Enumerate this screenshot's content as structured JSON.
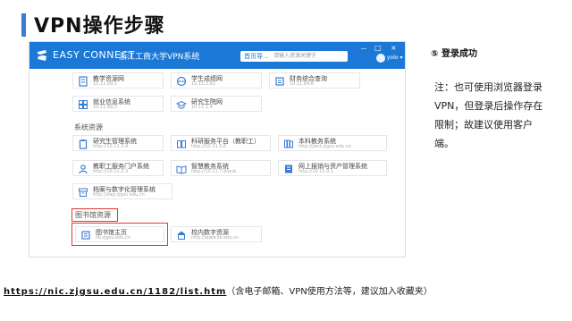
{
  "slide_title": "VPN操作步骤",
  "app": {
    "brand": "EASY CONNECT",
    "system_name": "浙江工商大学VPN系统",
    "nav_button": "首页导...",
    "search_placeholder": "请输入资源关键字",
    "window_controls": [
      "－",
      "□",
      "×"
    ],
    "user": "yolo ▾"
  },
  "resources": {
    "row1": [
      {
        "title": "教学资源网",
        "sub": "10.11.89.1"
      },
      {
        "title": "学生成绩网",
        "sub": "10.11.3.62"
      },
      {
        "title": "财务综合查询",
        "sub": "10.11.84.6"
      }
    ],
    "row2": [
      {
        "title": "就业信息系统",
        "sub": "10.11.89.2"
      },
      {
        "title": "研究生院网",
        "sub": "10.11.1.4"
      }
    ],
    "section_label": "系统资源",
    "row3": [
      {
        "title": "研究生管理系统",
        "sub": "http://10.11.3.4"
      },
      {
        "title": "科研服务平台（教职工）",
        "sub": "http://10.11.5.6"
      },
      {
        "title": "本科教务系统",
        "sub": "http://jwxt.zjgsu.edu.cn"
      }
    ],
    "row4": [
      {
        "title": "教职工服务门户系统",
        "sub": "http://10.11.2.3"
      },
      {
        "title": "智慧教务系统",
        "sub": "http://10.11.7.8/pub"
      },
      {
        "title": "网上报销与资产管理系统",
        "sub": "http://10.11.9.1"
      }
    ],
    "row5": [
      {
        "title": "档案与数字化管理系统",
        "sub": "http://dag.zjgsu.edu.cn"
      }
    ],
    "network_section_label": "图书馆资源",
    "row6": [
      {
        "title": "图书馆主页",
        "sub": "lib.zjgsu.edu.cn"
      },
      {
        "title": "校内数字资源",
        "sub": "http://www.lib.edu.cn"
      }
    ]
  },
  "step": {
    "label": "⑤  登录成功",
    "note": "注：也可使用浏览器登录VPN，但登录后操作存在限制；故建议使用客户端。"
  },
  "footer": {
    "link": "https://nic.zjgsu.edu.cn/1182/list.htm",
    "text": "（含电子邮箱、VPN使用方法等，建议加入收藏夹）"
  },
  "colors": {
    "title_accent": "#3a7bd5",
    "app_header": "#1b78d6",
    "highlight": "#e8362e"
  }
}
